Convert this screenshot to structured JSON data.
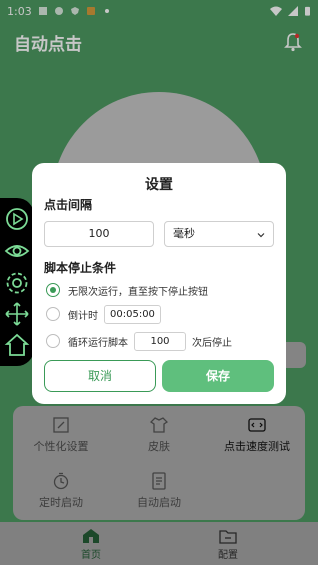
{
  "statusbar": {
    "time": "1:03"
  },
  "app": {
    "title": "自动点击"
  },
  "features": [
    {
      "label": "个性化设置",
      "icon": "edit-icon"
    },
    {
      "label": "皮肤",
      "icon": "shirt-icon"
    },
    {
      "label": "点击速度测试",
      "icon": "code-icon"
    },
    {
      "label": "定时启动",
      "icon": "timer-icon"
    },
    {
      "label": "自动启动",
      "icon": "document-icon"
    }
  ],
  "bottom_nav": [
    {
      "label": "首页",
      "icon": "home-icon",
      "active": true
    },
    {
      "label": "配置",
      "icon": "folder-icon",
      "active": false
    }
  ],
  "dialog": {
    "title": "设置",
    "interval_label": "点击间隔",
    "interval_value": "100",
    "unit_selected": "毫秒",
    "stop_label": "脚本停止条件",
    "options": {
      "infinite": "无限次运行，直至按下停止按钮",
      "countdown_label": "倒计时",
      "countdown_value": "00:05:00",
      "loop_label": "循环运行脚本",
      "loop_value": "100",
      "loop_suffix": "次后停止"
    },
    "cancel": "取消",
    "save": "保存"
  },
  "colors": {
    "primary": "#3a9a57",
    "save_button": "#5fbf7d",
    "header_green": "#4d9a62"
  }
}
